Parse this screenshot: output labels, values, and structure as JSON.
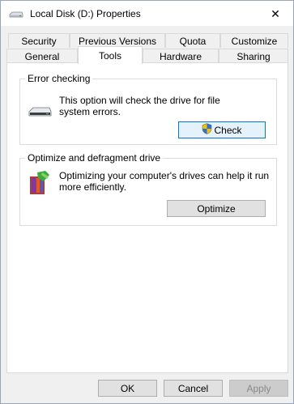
{
  "window": {
    "title": "Local Disk (D:) Properties",
    "close_glyph": "✕"
  },
  "tabs": {
    "row1": [
      "Security",
      "Previous Versions",
      "Quota",
      "Customize"
    ],
    "row2": [
      "General",
      "Tools",
      "Hardware",
      "Sharing"
    ],
    "active": "Tools"
  },
  "error_checking": {
    "title": "Error checking",
    "description": "This option will check the drive for file system errors.",
    "button_label": "Check",
    "icon": "drive-icon"
  },
  "optimize": {
    "title": "Optimize and defragment drive",
    "description": "Optimizing your computer's drives can help it run more efficiently.",
    "button_label": "Optimize",
    "icon": "defrag-icon"
  },
  "footer": {
    "ok_label": "OK",
    "cancel_label": "Cancel",
    "apply_label": "Apply"
  },
  "colors": {
    "accent": "#0078d7",
    "window_bg": "#f0f0f0",
    "panel_bg": "#ffffff"
  }
}
